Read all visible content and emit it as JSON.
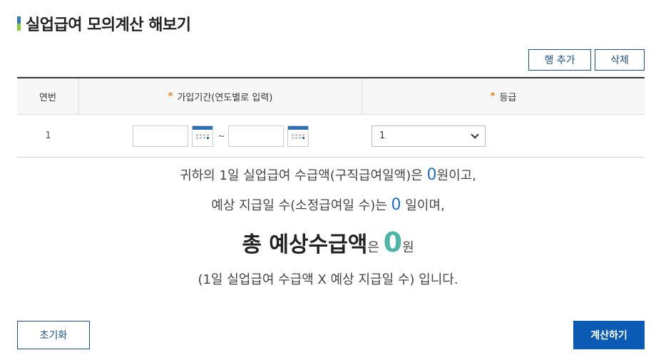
{
  "page": {
    "title": "실업급여 모의계산 해보기"
  },
  "toolbar": {
    "add_row_label": "행 추가",
    "delete_label": "삭제"
  },
  "table": {
    "columns": [
      {
        "label": "연번",
        "required": false
      },
      {
        "label": "가입기간(연도별로 입력)",
        "required": true
      },
      {
        "label": "등급",
        "required": true
      }
    ],
    "required_mark": "*",
    "rows": [
      {
        "index": "1",
        "start_date": "",
        "end_date": "",
        "separator": "~",
        "grade": "1"
      }
    ]
  },
  "result": {
    "line1_prefix": "귀하의 1일 실업급여 수급액(구직급여일액)은 ",
    "daily_amount": "0",
    "line1_suffix": "원이고,",
    "line2_prefix": "예상 지급일 수(소정급여일 수)는 ",
    "days": "0",
    "line2_suffix": " 일이며,",
    "total_label": "총 예상수급액",
    "total_particle": "은 ",
    "total_amount": "0",
    "total_unit": "원",
    "formula": "(1일 실업급여 수급액 X 예상 지급일 수) 입니다."
  },
  "footer": {
    "reset_label": "초기화",
    "calculate_label": "계산하기"
  },
  "colors": {
    "brand_blue": "#0b5bb5",
    "accent_green": "#8dc63f",
    "required_orange": "#f07d1a",
    "number_blue": "#1a6fd1",
    "total_teal": "#4cb6a8"
  }
}
